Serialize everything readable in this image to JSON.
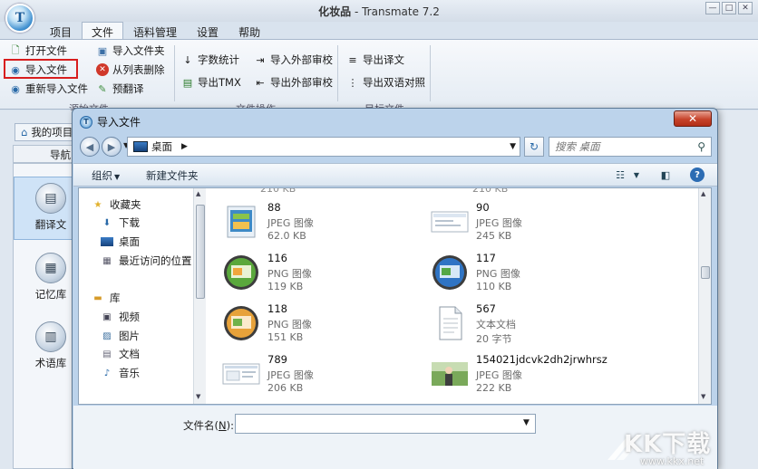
{
  "app": {
    "title_name": "化妆品",
    "title_app": "Transmate 7.2",
    "logo_letter": "T",
    "window_controls": [
      "—",
      "□",
      "✕"
    ]
  },
  "menu": {
    "tabs": [
      "项目",
      "文件",
      "语料管理",
      "设置",
      "帮助"
    ],
    "active": "文件"
  },
  "ribbon": {
    "buttons": {
      "open_file": "打开文件",
      "import_file": "导入文件",
      "reimport_file": "重新导入文件",
      "import_folder": "导入文件夹",
      "remove_from_list": "从列表删除",
      "pre_translate": "预翻译",
      "word_count": "字数统计",
      "export_tmx": "导出TMX",
      "import_external_review": "导入外部审校",
      "export_external_review": "导出外部审校",
      "export_translation": "导出译文",
      "export_bilingual": "导出双语对照"
    },
    "groups": [
      "源始文件",
      "文件操作",
      "目标文件"
    ]
  },
  "left_panel": {
    "project_tab": "我的项目",
    "nav_header": "导航",
    "items": [
      "翻译文",
      "记忆库",
      "术语库"
    ]
  },
  "dialog": {
    "title": "导入文件",
    "close_label": "✕",
    "address": "桌面",
    "search_placeholder": "搜索 桌面",
    "toolbar": {
      "organize": "组织",
      "new_folder": "新建文件夹"
    },
    "tree": {
      "favorites": "收藏夹",
      "downloads": "下载",
      "desktop": "桌面",
      "recent": "最近访问的位置",
      "libraries": "库",
      "videos": "视频",
      "pictures": "图片",
      "documents": "文档",
      "music": "音乐"
    },
    "files": [
      {
        "name": "88",
        "type": "JPEG 图像",
        "size": "62.0 KB",
        "thumb": "screenshot-blue"
      },
      {
        "name": "90",
        "type": "JPEG 图像",
        "size": "245 KB",
        "thumb": "screenshot-white"
      },
      {
        "name": "116",
        "type": "PNG 图像",
        "size": "119 KB",
        "thumb": "round-green"
      },
      {
        "name": "117",
        "type": "PNG 图像",
        "size": "110 KB",
        "thumb": "round-blue"
      },
      {
        "name": "118",
        "type": "PNG 图像",
        "size": "151 KB",
        "thumb": "round-orange"
      },
      {
        "name": "567",
        "type": "文本文档",
        "size": "20 字节",
        "thumb": "text-doc"
      },
      {
        "name": "789",
        "type": "JPEG 图像",
        "size": "206 KB",
        "thumb": "screenshot-white"
      },
      {
        "name": "154021jdcvk2dh2jrwhrsz",
        "type": "JPEG 图像",
        "size": "222 KB",
        "thumb": "photo"
      }
    ],
    "filename_label_prefix": "文件名(",
    "filename_label_key": "N",
    "filename_label_suffix": "):",
    "filename_value": ""
  },
  "watermark": {
    "text": "KK下载",
    "url": "www.kkx.net"
  },
  "colors": {
    "accent": "#2a6aa8",
    "highlight_border": "#d81e1e",
    "close_button": "#c7432b"
  }
}
